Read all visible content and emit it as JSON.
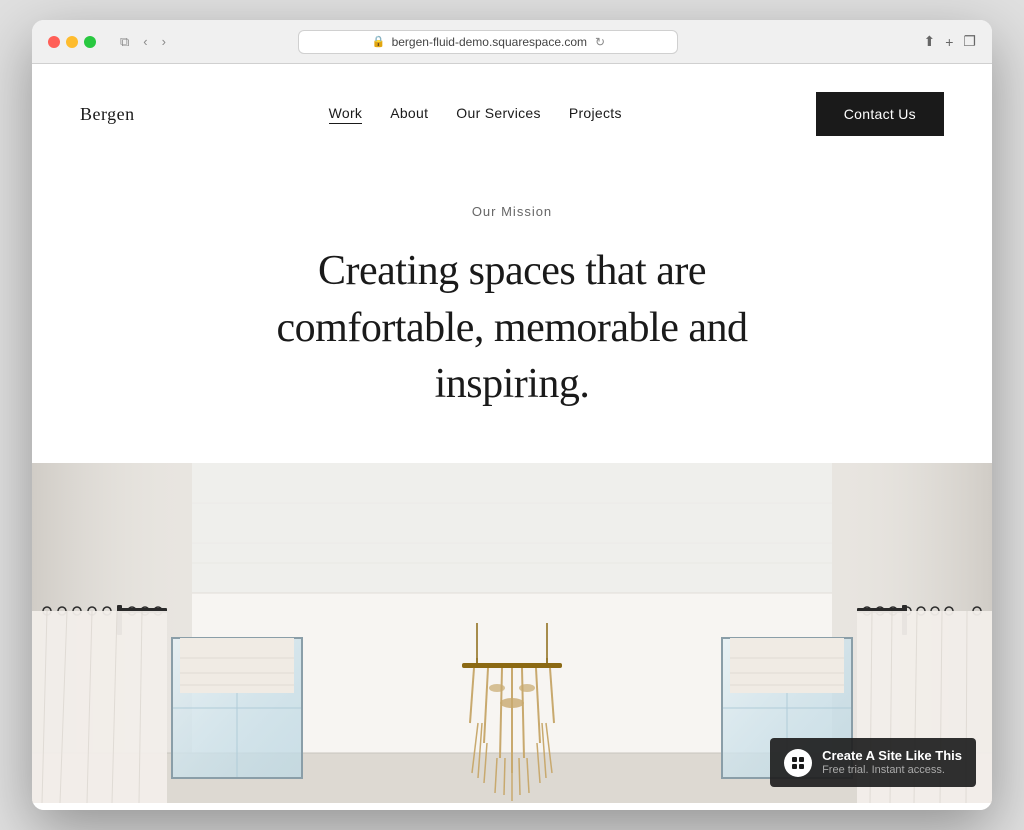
{
  "browser": {
    "url": "bergen-fluid-demo.squarespace.com",
    "back_icon": "‹",
    "forward_icon": "›",
    "tab_icon": "⧉",
    "share_icon": "↑",
    "add_tab_icon": "+",
    "copy_icon": "❐"
  },
  "navbar": {
    "brand": "Bergen",
    "nav_items": [
      {
        "label": "Work",
        "active": true
      },
      {
        "label": "About",
        "active": false
      },
      {
        "label": "Our Services",
        "active": false
      },
      {
        "label": "Projects",
        "active": false
      }
    ],
    "cta_label": "Contact Us"
  },
  "hero": {
    "mission_label": "Our Mission",
    "headline_line1": "Creating spaces that are",
    "headline_line2": "comfortable, memorable and",
    "headline_line3": "inspiring."
  },
  "create_site_badge": {
    "main_text": "Create A Site Like This",
    "sub_text": "Free trial. Instant access."
  }
}
